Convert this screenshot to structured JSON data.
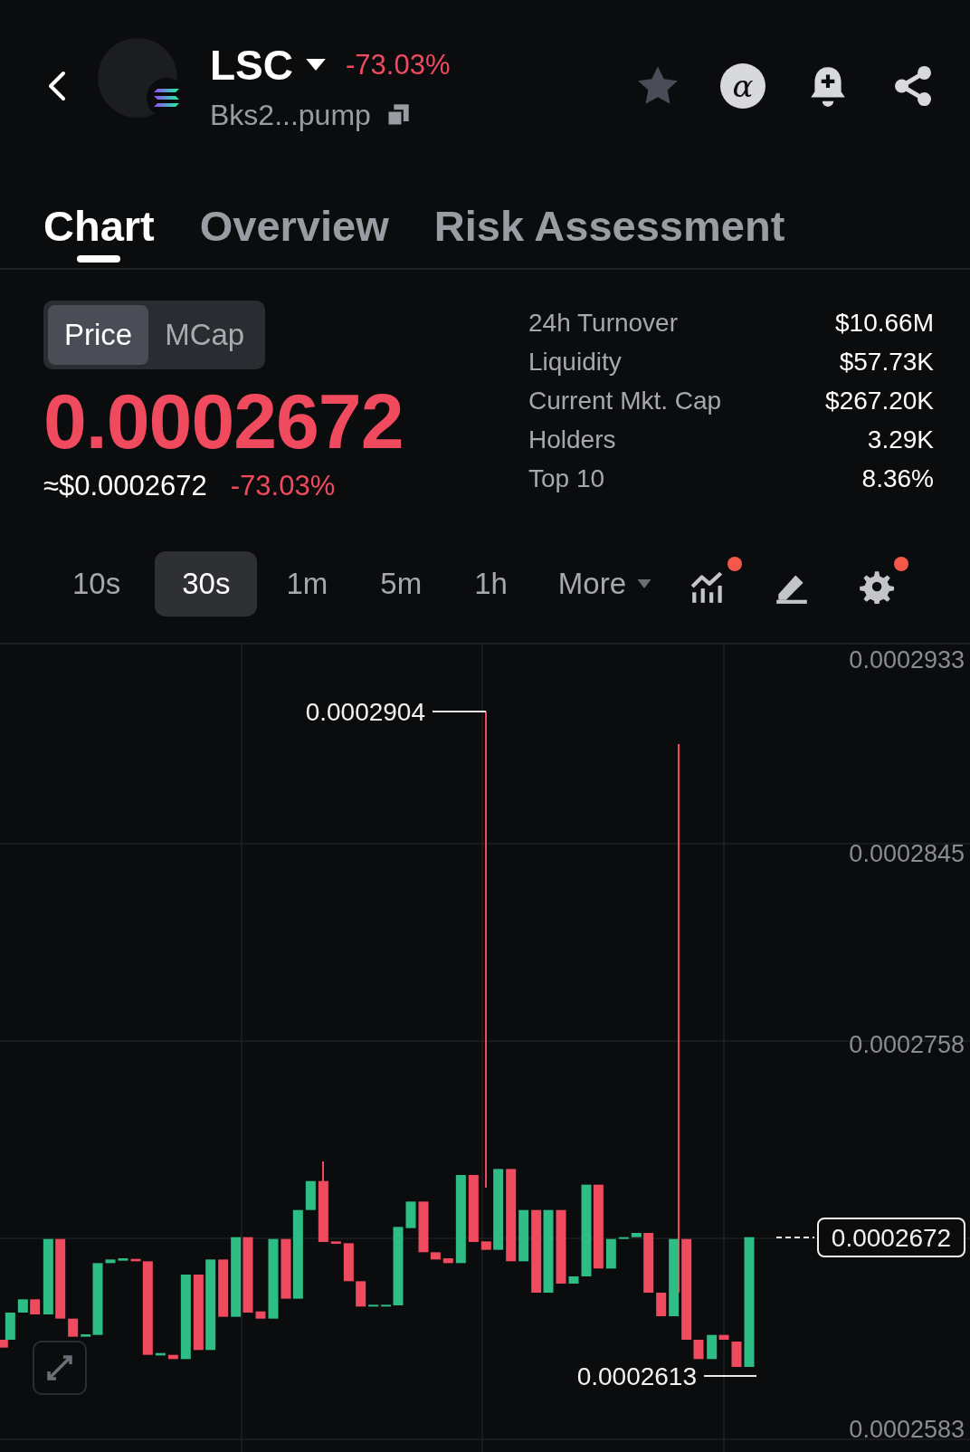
{
  "header": {
    "symbol": "LSC",
    "change": "-73.03%",
    "address": "Bks2...pump",
    "alpha_badge": "α"
  },
  "tabs": [
    {
      "label": "Chart",
      "selected": true
    },
    {
      "label": "Overview",
      "selected": false
    },
    {
      "label": "Risk Assessment",
      "selected": false
    }
  ],
  "price_toggle": [
    {
      "label": "Price",
      "selected": true
    },
    {
      "label": "MCap",
      "selected": false
    }
  ],
  "price": {
    "value": "0.0002672",
    "usd": "≈$0.0002672",
    "change": "-73.03%"
  },
  "stats": [
    {
      "label": "24h Turnover",
      "value": "$10.66M"
    },
    {
      "label": "Liquidity",
      "value": "$57.73K"
    },
    {
      "label": "Current Mkt. Cap",
      "value": "$267.20K"
    },
    {
      "label": "Holders",
      "value": "3.29K"
    },
    {
      "label": "Top 10",
      "value": "8.36%"
    }
  ],
  "timeframes": [
    {
      "label": "10s",
      "selected": false
    },
    {
      "label": "30s",
      "selected": true
    },
    {
      "label": "1m",
      "selected": false
    },
    {
      "label": "5m",
      "selected": false
    },
    {
      "label": "1h",
      "selected": false
    }
  ],
  "more_label": "More",
  "tools": [
    {
      "kind": "indicators",
      "notify": true
    },
    {
      "kind": "draw",
      "notify": false
    },
    {
      "kind": "settings",
      "notify": true
    }
  ],
  "chart": {
    "y_labels": [
      "0.0002933",
      "0.0002845",
      "0.0002758",
      "0.0002583"
    ],
    "high_label": "0.0002904",
    "low_label": "0.0002613",
    "current_price": "0.0002672"
  }
}
